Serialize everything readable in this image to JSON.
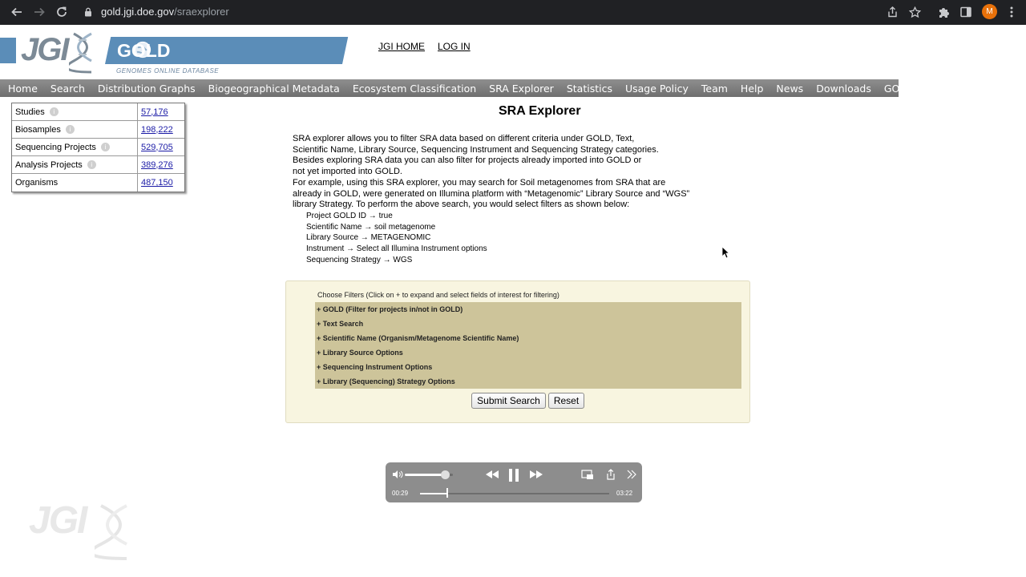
{
  "browser": {
    "url_host": "gold.jgi.doe.gov",
    "url_path": "/sraexplorer",
    "profile_initial": "M",
    "icons": [
      "back-arrow-icon",
      "forward-arrow-icon",
      "reload-icon",
      "lock-icon",
      "share-icon",
      "star-icon",
      "puzzle-icon",
      "sidepanel-icon",
      "kebab-icon"
    ]
  },
  "header": {
    "jgi_logo": "JGI",
    "gold_logo": "GOLD",
    "gold_subtitle": "GENOMES ONLINE DATABASE",
    "links": [
      "JGI HOME",
      "LOG IN"
    ]
  },
  "menu": [
    "Home",
    "Search",
    "Distribution Graphs",
    "Biogeographical Metadata",
    "Ecosystem Classification",
    "SRA Explorer",
    "Statistics",
    "Usage Policy",
    "Team",
    "Help",
    "News",
    "Downloads",
    "GOLD API"
  ],
  "stats": [
    {
      "label": "Studies",
      "value": "57,176",
      "info": true
    },
    {
      "label": "Biosamples",
      "value": "198,222",
      "info": true
    },
    {
      "label": "Sequencing Projects",
      "value": "529,705",
      "info": true
    },
    {
      "label": "Analysis Projects",
      "value": "389,276",
      "info": true
    },
    {
      "label": "Organisms",
      "value": "487,150",
      "info": false
    }
  ],
  "page": {
    "title": "SRA Explorer",
    "description": [
      "SRA explorer allows you to filter SRA data based on different criteria under GOLD, Text,",
      "Scientific Name, Library Source, Sequencing Instrument and Sequencing Strategy categories.",
      "Besides exploring SRA data you can also filter for projects already imported into GOLD or",
      "not yet imported into GOLD.",
      "For example, using this SRA explorer, you may search for Soil metagenomes from SRA that are",
      "already in GOLD, were generated on Illumina platform with “Metagenomic” Library Source and “WGS”",
      "library Strategy. To perform the above search, you would select filters as shown below:"
    ],
    "example_filters": [
      "Project GOLD ID → true",
      "Scientific Name → soil metagenome",
      "Library Source → METAGENOMIC",
      "Instrument → Select all Illumina Instrument options",
      "Sequencing Strategy → WGS"
    ]
  },
  "filters": {
    "title": "Choose Filters (Click on + to expand and select fields of interest for filtering)",
    "items": [
      "+ GOLD (Filter for projects in/not in GOLD)",
      "+ Text Search",
      "+ Scientific Name (Organism/Metagenome Scientific Name)",
      "+ Library Source Options",
      "+ Sequencing Instrument Options",
      "+ Library (Sequencing) Strategy Options"
    ],
    "submit_label": "Submit Search",
    "reset_label": "Reset"
  },
  "player": {
    "current_time": "00:29",
    "duration": "03:22",
    "progress": 0.144,
    "volume": 0.83
  },
  "watermark": "JGI"
}
